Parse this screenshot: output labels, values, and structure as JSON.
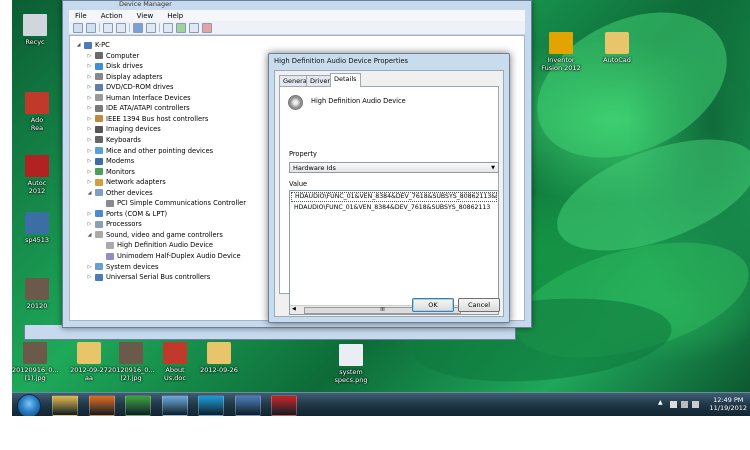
{
  "desktop_icons": [
    {
      "id": "recycle",
      "label": "Recyc",
      "icon": "recycle-bin-icon"
    },
    {
      "id": "adobe",
      "label": "Ado\nRea",
      "icon": "pdf-icon"
    },
    {
      "id": "autocad2012",
      "label": "Autoc\n2012",
      "icon": "autocad-icon"
    },
    {
      "id": "sp4513",
      "label": "sp4513",
      "icon": "program-icon"
    },
    {
      "id": "img2012",
      "label": "20120",
      "icon": "photo-icon"
    },
    {
      "id": "inventor",
      "label": "Inventor\nFusion 2012",
      "icon": "inventor-icon"
    },
    {
      "id": "autocad",
      "label": "AutoCad",
      "icon": "folder-icon"
    },
    {
      "id": "photo1",
      "label": "20120916_0...\n(1).jpg",
      "icon": "photo-icon"
    },
    {
      "id": "folder1",
      "label": "2012-09-27\naa",
      "icon": "folder-icon"
    },
    {
      "id": "photo2",
      "label": "20120916_0...\n(2).jpg",
      "icon": "photo-icon"
    },
    {
      "id": "about",
      "label": "About\nUs.doc",
      "icon": "pdf-icon"
    },
    {
      "id": "folder2",
      "label": "2012-09-26",
      "icon": "folder-icon"
    },
    {
      "id": "specs",
      "label": "system\nspecs.png",
      "icon": "image-file-icon"
    }
  ],
  "device_manager": {
    "title": "Device Manager",
    "menu": [
      "File",
      "Action",
      "View",
      "Help"
    ],
    "tree": [
      {
        "label": "K-PC",
        "level": 0,
        "expander": "◢"
      },
      {
        "label": "Computer",
        "level": 1,
        "expander": "▷"
      },
      {
        "label": "Disk drives",
        "level": 1,
        "expander": "▷"
      },
      {
        "label": "Display adapters",
        "level": 1,
        "expander": "▷"
      },
      {
        "label": "DVD/CD-ROM drives",
        "level": 1,
        "expander": "▷"
      },
      {
        "label": "Human Interface Devices",
        "level": 1,
        "expander": "▷"
      },
      {
        "label": "IDE ATA/ATAPI controllers",
        "level": 1,
        "expander": "▷"
      },
      {
        "label": "IEEE 1394 Bus host controllers",
        "level": 1,
        "expander": "▷"
      },
      {
        "label": "Imaging devices",
        "level": 1,
        "expander": "▷"
      },
      {
        "label": "Keyboards",
        "level": 1,
        "expander": "▷"
      },
      {
        "label": "Mice and other pointing devices",
        "level": 1,
        "expander": "▷"
      },
      {
        "label": "Modems",
        "level": 1,
        "expander": "▷"
      },
      {
        "label": "Monitors",
        "level": 1,
        "expander": "▷"
      },
      {
        "label": "Network adapters",
        "level": 1,
        "expander": "▷"
      },
      {
        "label": "Other devices",
        "level": 1,
        "expander": "◢"
      },
      {
        "label": "PCI Simple Communications Controller",
        "level": 2,
        "expander": ""
      },
      {
        "label": "Ports (COM & LPT)",
        "level": 1,
        "expander": "▷"
      },
      {
        "label": "Processors",
        "level": 1,
        "expander": "▷"
      },
      {
        "label": "Sound, video and game controllers",
        "level": 1,
        "expander": "◢"
      },
      {
        "label": "High Definition Audio Device",
        "level": 2,
        "expander": ""
      },
      {
        "label": "Unimodem Half-Duplex Audio Device",
        "level": 2,
        "expander": ""
      },
      {
        "label": "System devices",
        "level": 1,
        "expander": "▷"
      },
      {
        "label": "Universal Serial Bus controllers",
        "level": 1,
        "expander": "▷"
      }
    ]
  },
  "properties_dialog": {
    "title": "High Definition Audio Device Properties",
    "tabs": [
      "General",
      "Driver",
      "Details"
    ],
    "active_tab": "Details",
    "device_name": "High Definition Audio Device",
    "property_label": "Property",
    "property_value": "Hardware Ids",
    "value_label": "Value",
    "values": [
      "HDAUDIO\\FUNC_01&VEN_8384&DEV_7618&SUBSYS_80862113&REV",
      "HDAUDIO\\FUNC_01&VEN_8384&DEV_7618&SUBSYS_80862113"
    ],
    "scroll_grip": "III",
    "ok_label": "OK",
    "cancel_label": "Cancel"
  },
  "taskbar": {
    "start": "windows-start-orb",
    "pinned": [
      "explorer-icon",
      "media-player-icon",
      "chrome-icon",
      "network-icon",
      "skype-icon",
      "remote-desktop-icon",
      "toolbox-icon"
    ],
    "clock_time": "12:49 PM",
    "clock_date": "11/19/2012"
  }
}
